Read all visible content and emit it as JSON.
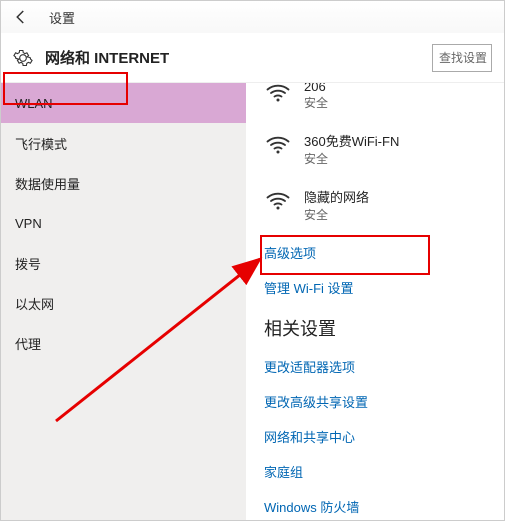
{
  "titlebar": {
    "title": "设置"
  },
  "header": {
    "title": "网络和 INTERNET",
    "search_placeholder": "查找设置"
  },
  "sidebar": {
    "items": [
      {
        "label": "WLAN",
        "selected": true
      },
      {
        "label": "飞行模式",
        "selected": false
      },
      {
        "label": "数据使用量",
        "selected": false
      },
      {
        "label": "VPN",
        "selected": false
      },
      {
        "label": "拨号",
        "selected": false
      },
      {
        "label": "以太网",
        "selected": false
      },
      {
        "label": "代理",
        "selected": false
      }
    ]
  },
  "content": {
    "networks": [
      {
        "name": "206",
        "status": "安全"
      },
      {
        "name": "360免费WiFi-FN",
        "status": "安全"
      },
      {
        "name": "隐藏的网络",
        "status": "安全"
      }
    ],
    "advanced_link": "高级选项",
    "manage_link": "管理 Wi-Fi 设置",
    "related_title": "相关设置",
    "related_links": [
      "更改适配器选项",
      "更改高级共享设置",
      "网络和共享中心",
      "家庭组",
      "Windows 防火墙"
    ]
  }
}
